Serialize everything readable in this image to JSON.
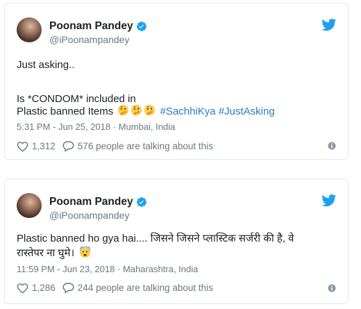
{
  "tweets": [
    {
      "author_name": "Poonam Pandey",
      "handle": "@iPoonampandey",
      "line1": "Just asking..",
      "line2": "Is *CONDOM* included in",
      "line3_text": "Plastic banned Items",
      "hashtag1": "#SachhiKya",
      "hashtag2": "#JustAsking",
      "emojis": [
        "thinking-face-emoji",
        "thinking-face-emoji",
        "thinking-face-emoji"
      ],
      "timestamp": "5:31 PM - Jun 25, 2018 · Mumbai, India",
      "likes": "1,312",
      "talking": "576 people are talking about this"
    },
    {
      "author_name": "Poonam Pandey",
      "handle": "@iPoonampandey",
      "line1": "Plastic banned ho gya hai.... जिसने जिसने प्लास्टिक सर्जरी की है, वे",
      "line2": "रास्तेपर ना घुमे।",
      "emojis": [
        "anxious-face-emoji"
      ],
      "timestamp": "11:59 PM - Jun 23, 2018 · Maharashtra, India",
      "likes": "1,286",
      "talking": "244 people are talking about this"
    }
  ],
  "colors": {
    "link": "#2b7bb9",
    "twitter_blue": "#1da1f2",
    "muted": "#697882",
    "border": "#e1e8ed",
    "emoji_yellow": "#ffcc4d"
  }
}
